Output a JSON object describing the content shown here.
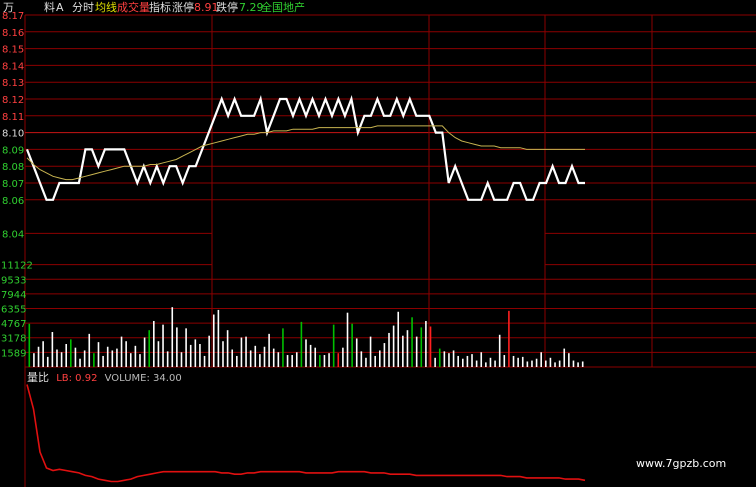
{
  "header": {
    "wan": "万",
    "liao": "料",
    "a": "A",
    "tab_fenshi": "分时",
    "tab_junxian": "均线",
    "tab_chengjiaoliang": "成交量",
    "tab_zhibiao": "指标",
    "limit_up_label": "涨停",
    "limit_up_value": "8.91",
    "limit_down_label": "跌停",
    "limit_down_value": "7.29",
    "stock_name": "全国地产"
  },
  "sub_header": {
    "indicator": "量比",
    "lb_text": "LB: 0.92",
    "volume_text": "VOLUME: 34.00"
  },
  "watermark": "www.7gpzb.com",
  "colors": {
    "background": "#000000",
    "grid": "#8b0000",
    "price_line": "#ffffff",
    "avg_line": "#c8b450",
    "up": "#ff3030",
    "down": "#00c000",
    "neutral": "#ffffff",
    "ratio_line": "#e01010",
    "label_red": "#ff4040",
    "label_green": "#30d030",
    "label_yellow": "#e0e000"
  },
  "chart_data": [
    {
      "type": "line",
      "name": "price",
      "y_ticks": [
        "8.17",
        "8.16",
        "8.15",
        "8.14",
        "8.13",
        "8.12",
        "8.11",
        "8.10",
        "8.09",
        "8.08",
        "8.07",
        "8.06",
        "8.04"
      ],
      "ylim": [
        8.045,
        8.17
      ],
      "price": [
        8.09,
        8.08,
        8.07,
        8.06,
        8.06,
        8.07,
        8.07,
        8.07,
        8.07,
        8.09,
        8.09,
        8.08,
        8.09,
        8.09,
        8.09,
        8.09,
        8.08,
        8.07,
        8.08,
        8.07,
        8.08,
        8.07,
        8.08,
        8.08,
        8.07,
        8.08,
        8.08,
        8.09,
        8.1,
        8.11,
        8.12,
        8.11,
        8.12,
        8.11,
        8.11,
        8.11,
        8.12,
        8.1,
        8.11,
        8.12,
        8.12,
        8.11,
        8.12,
        8.11,
        8.12,
        8.11,
        8.12,
        8.11,
        8.12,
        8.11,
        8.12,
        8.1,
        8.11,
        8.11,
        8.12,
        8.11,
        8.11,
        8.12,
        8.11,
        8.12,
        8.11,
        8.11,
        8.11,
        8.1,
        8.1,
        8.07,
        8.08,
        8.07,
        8.06,
        8.06,
        8.06,
        8.07,
        8.06,
        8.06,
        8.06,
        8.07,
        8.07,
        8.06,
        8.06,
        8.07,
        8.07,
        8.08,
        8.07,
        8.07,
        8.08,
        8.07,
        8.07
      ],
      "avg": [
        8.085,
        8.081,
        8.078,
        8.076,
        8.074,
        8.073,
        8.072,
        8.072,
        8.073,
        8.074,
        8.075,
        8.076,
        8.077,
        8.078,
        8.079,
        8.08,
        8.08,
        8.08,
        8.08,
        8.081,
        8.081,
        8.082,
        8.083,
        8.084,
        8.086,
        8.088,
        8.09,
        8.092,
        8.093,
        8.094,
        8.095,
        8.096,
        8.097,
        8.098,
        8.099,
        8.099,
        8.1,
        8.1,
        8.101,
        8.101,
        8.101,
        8.102,
        8.102,
        8.102,
        8.102,
        8.103,
        8.103,
        8.103,
        8.103,
        8.103,
        8.103,
        8.103,
        8.103,
        8.103,
        8.104,
        8.104,
        8.104,
        8.104,
        8.104,
        8.104,
        8.104,
        8.104,
        8.104,
        8.104,
        8.104,
        8.1,
        8.097,
        8.095,
        8.094,
        8.093,
        8.092,
        8.092,
        8.092,
        8.091,
        8.091,
        8.091,
        8.091,
        8.09,
        8.09,
        8.09,
        8.09,
        8.09,
        8.09,
        8.09,
        8.09,
        8.09,
        8.09
      ]
    },
    {
      "type": "bar",
      "name": "volume",
      "y_ticks": [
        "11122",
        "9533",
        "7944",
        "6355",
        "4767",
        "3178",
        "1589"
      ],
      "ylim": [
        0,
        12711
      ],
      "values": [
        4700,
        1500,
        2200,
        2800,
        1100,
        3800,
        1900,
        1600,
        2500,
        3000,
        2100,
        900,
        1800,
        3600,
        1500,
        2700,
        1200,
        2200,
        1800,
        2000,
        3300,
        2800,
        1500,
        2300,
        1400,
        3200,
        4000,
        5000,
        2800,
        4600,
        1700,
        6500,
        4300,
        1600,
        4200,
        2400,
        3000,
        2500,
        1200,
        3400,
        5700,
        6200,
        2800,
        4000,
        1900,
        1200,
        3200,
        3300,
        1800,
        2300,
        1400,
        2200,
        3600,
        2000,
        1600,
        4200,
        1300,
        1300,
        1600,
        4900,
        3000,
        2400,
        2100,
        1300,
        1300,
        1500,
        4600,
        1500,
        2100,
        5900,
        4700,
        3100,
        1700,
        1000,
        3300,
        1200,
        1800,
        2600,
        3700,
        4500,
        6000,
        3400,
        4000,
        5400,
        3300,
        4300,
        5000,
        4400,
        1000,
        2000,
        1700,
        1500,
        1800,
        1200,
        900,
        1200,
        1400,
        700,
        1600,
        500,
        1000,
        700,
        3500,
        1300,
        6100,
        1200,
        1000,
        1100,
        600,
        700,
        900,
        1600,
        700,
        1000,
        500,
        700,
        2000,
        1500,
        700,
        500,
        600
      ],
      "colors": [
        "g",
        "w",
        "w",
        "w",
        "w",
        "w",
        "w",
        "w",
        "w",
        "g",
        "w",
        "w",
        "w",
        "w",
        "g",
        "w",
        "w",
        "w",
        "w",
        "w",
        "w",
        "w",
        "w",
        "w",
        "w",
        "w",
        "g",
        "w",
        "w",
        "w",
        "w",
        "w",
        "w",
        "w",
        "w",
        "w",
        "w",
        "w",
        "w",
        "w",
        "w",
        "w",
        "w",
        "w",
        "w",
        "w",
        "w",
        "w",
        "w",
        "w",
        "w",
        "w",
        "w",
        "w",
        "w",
        "g",
        "w",
        "w",
        "w",
        "g",
        "w",
        "w",
        "w",
        "g",
        "w",
        "w",
        "g",
        "r",
        "w",
        "w",
        "g",
        "w",
        "w",
        "w",
        "w",
        "w",
        "w",
        "w",
        "w",
        "w",
        "w",
        "w",
        "w",
        "g",
        "w",
        "g",
        "w",
        "r",
        "w",
        "g",
        "w",
        "w",
        "w",
        "w",
        "w",
        "w",
        "w",
        "w",
        "w",
        "w",
        "w",
        "w",
        "w",
        "w",
        "r",
        "w",
        "w",
        "w",
        "w",
        "w",
        "w",
        "w",
        "w",
        "w",
        "w",
        "w",
        "w",
        "w",
        "w",
        "w",
        "w"
      ]
    },
    {
      "type": "line",
      "name": "volume_ratio",
      "values": [
        9.0,
        7.0,
        3.5,
        2.2,
        2.0,
        2.1,
        2.0,
        1.9,
        1.8,
        1.6,
        1.5,
        1.3,
        1.2,
        1.1,
        1.1,
        1.2,
        1.3,
        1.5,
        1.6,
        1.7,
        1.8,
        1.9,
        1.9,
        1.9,
        1.9,
        1.9,
        1.9,
        1.9,
        1.9,
        1.9,
        1.8,
        1.8,
        1.7,
        1.7,
        1.8,
        1.8,
        1.9,
        1.9,
        1.9,
        1.9,
        1.9,
        1.9,
        1.9,
        1.8,
        1.8,
        1.8,
        1.8,
        1.8,
        1.9,
        1.9,
        1.9,
        1.9,
        1.9,
        1.8,
        1.8,
        1.8,
        1.7,
        1.7,
        1.7,
        1.7,
        1.6,
        1.6,
        1.6,
        1.6,
        1.6,
        1.6,
        1.6,
        1.6,
        1.6,
        1.6,
        1.6,
        1.6,
        1.6,
        1.6,
        1.5,
        1.5,
        1.5,
        1.4,
        1.4,
        1.4,
        1.4,
        1.4,
        1.4,
        1.3,
        1.3,
        1.3,
        1.2
      ],
      "ylim": [
        0.9,
        9.2
      ]
    }
  ]
}
